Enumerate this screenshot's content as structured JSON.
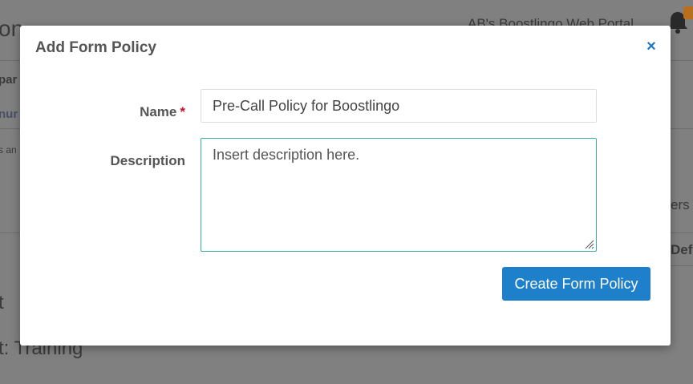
{
  "background": {
    "page_title_fragment": "on",
    "portal_name": "AB's Boostlingo Web Portal",
    "fragments": {
      "left1": "par",
      "left2": "nur",
      "left3": "s an",
      "right1": "ers",
      "right2": "Defa",
      "bottom1": "t",
      "bottom2": "t: Training"
    }
  },
  "modal": {
    "title": "Add Form Policy",
    "close_symbol": "×",
    "name_label": "Name",
    "required_marker": "*",
    "name_value": "Pre-Call Policy for Boostlingo",
    "description_label": "Description",
    "description_placeholder": "Insert description here.",
    "submit_label": "Create Form Policy"
  },
  "colors": {
    "accent": "#1e7fcb",
    "focus_border": "#3bb09b",
    "required": "#c8102e"
  }
}
